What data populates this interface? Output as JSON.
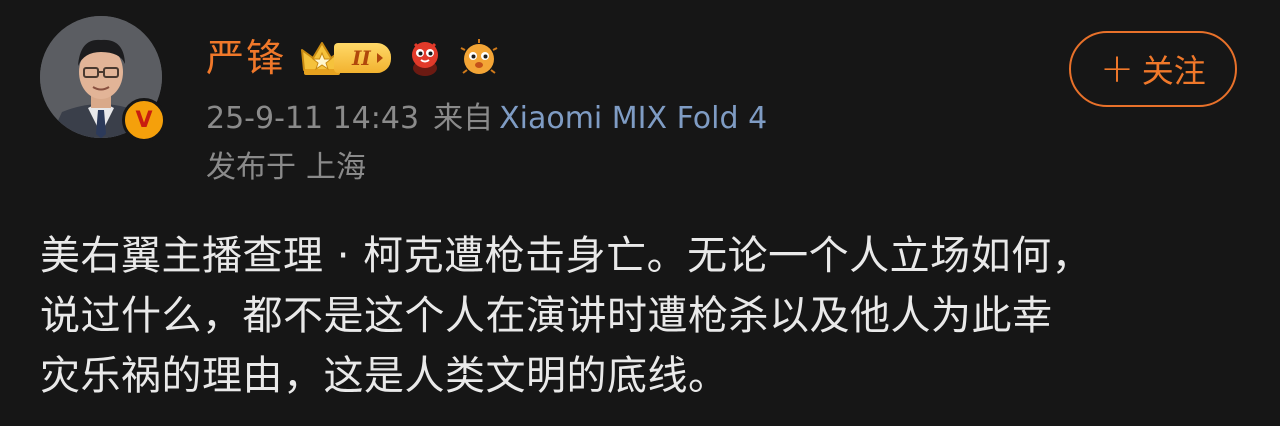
{
  "author": {
    "name": "严锋",
    "avatar_icon": "person-portrait",
    "verified_icon": "verified-v-badge",
    "verified_mark": "V",
    "rank_badge_text": "II",
    "badges": [
      "crown-icon",
      "red-mascot-icon",
      "pufferfish-icon"
    ]
  },
  "follow_button": {
    "plus": "+",
    "label": "关注"
  },
  "meta": {
    "timestamp": "25-9-11 14:43",
    "source_prefix": "来自",
    "source_device": "Xiaomi MIX Fold 4",
    "location_prefix": "发布于",
    "location": "上海"
  },
  "post": {
    "lines": [
      "美右翼主播查理 · 柯克遭枪击身亡。无论一个人立场如何，",
      "说过什么，都不是这个人在演讲时遭枪杀以及他人为此幸",
      "灾乐祸的理由，这是人类文明的底线。"
    ]
  },
  "colors": {
    "background": "#161616",
    "name": "#f0782a",
    "follow_border": "#e8712a",
    "meta": "#8a8a8a",
    "source_link": "#7f9cc4",
    "body_text": "#e9e9e9",
    "verified_badge": "#f5a00b"
  }
}
